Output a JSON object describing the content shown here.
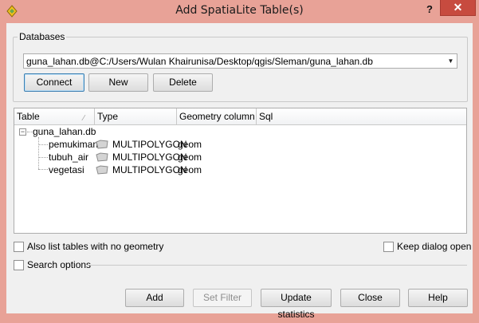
{
  "window": {
    "title": "Add SpatiaLite Table(s)",
    "help_glyph": "?",
    "close_glyph": "✕"
  },
  "databases": {
    "group_label": "Databases",
    "selected": "guna_lahan.db@C:/Users/Wulan Khairunisa/Desktop/qgis/Sleman/guna_lahan.db",
    "buttons": {
      "connect": "Connect",
      "new": "New",
      "delete": "Delete"
    }
  },
  "tree": {
    "columns": [
      "Table",
      "Type",
      "Geometry column",
      "Sql"
    ],
    "root": {
      "label": "guna_lahan.db",
      "expander": "−"
    },
    "rows": [
      {
        "table": "pemukiman",
        "type": "MULTIPOLYGON",
        "geometry": "geom",
        "sql": ""
      },
      {
        "table": "tubuh_air",
        "type": "MULTIPOLYGON",
        "geometry": "geom",
        "sql": ""
      },
      {
        "table": "vegetasi",
        "type": "MULTIPOLYGON",
        "geometry": "geom",
        "sql": ""
      }
    ]
  },
  "options": {
    "list_no_geometry": "Also list tables with no geometry",
    "keep_dialog_open": "Keep dialog open",
    "search_options": "Search options"
  },
  "footer": {
    "add": "Add",
    "set_filter": "Set Filter",
    "update_statistics": "Update statistics",
    "close": "Close",
    "help": "Help"
  },
  "colors": {
    "title_bar": "#e8a297",
    "close_button": "#c74b3f",
    "dialog_bg": "#f0f0f0",
    "geometry_icon": "#c8c8c8"
  },
  "icons": {
    "app": "qgis-icon",
    "expander": "collapse-box-icon",
    "geometry": "polygon-layer-icon"
  }
}
